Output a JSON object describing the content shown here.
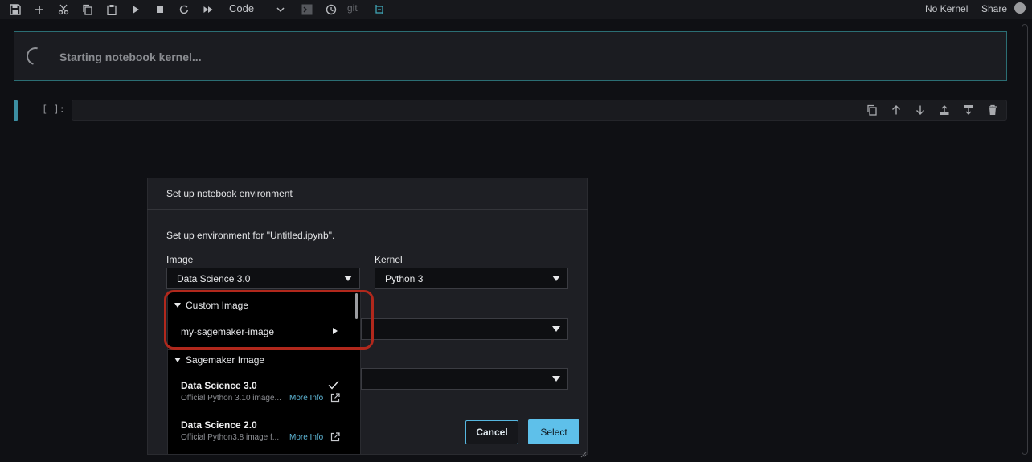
{
  "toolbar": {
    "cell_type": "Code",
    "git_label": "git",
    "kernel_status": "No Kernel",
    "share_label": "Share"
  },
  "banner": {
    "text": "Starting notebook kernel..."
  },
  "cell": {
    "prompt": "[ ]:"
  },
  "modal": {
    "title": "Set up notebook environment",
    "description": "Set up environment for \"Untitled.ipynb\".",
    "image_label": "Image",
    "image_value": "Data Science 3.0",
    "kernel_label": "Kernel",
    "kernel_value": "Python 3",
    "cancel_label": "Cancel",
    "select_label": "Select"
  },
  "dropdown": {
    "custom_group": "Custom Image",
    "custom_items": [
      "my-sagemaker-image"
    ],
    "sagemaker_group": "Sagemaker Image",
    "sagemaker_items": [
      {
        "title": "Data Science 3.0",
        "desc": "Official Python 3.10 image...",
        "more_info": "More Info",
        "selected": true
      },
      {
        "title": "Data Science 2.0",
        "desc": "Official Python3.8 image f...",
        "more_info": "More Info",
        "selected": false
      }
    ]
  },
  "colors": {
    "accent": "#5ec0ea",
    "highlight": "#b1281c",
    "banner_border": "#2b6e74",
    "cell_marker": "#3c8ea2"
  }
}
